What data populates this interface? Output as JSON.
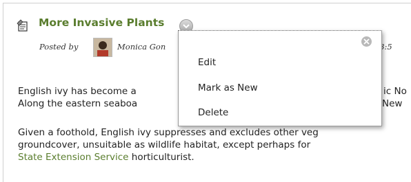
{
  "post": {
    "title": "More Invasive Plants",
    "posted_by": "Posted by",
    "author": "Monica Gon",
    "time": ":03:5"
  },
  "content": {
    "p1_line1_a": "English ivy has become a",
    "p1_line1_b": "ic No",
    "p1_line2_a": "Along the eastern seaboa",
    "p1_line2_b": "New",
    "p2_line1": "Given a foothold, English ivy suppresses and excludes other veg",
    "p2_line2": "groundcover, unsuitable as wildlife habitat, except perhaps for",
    "p2_line3_link": "State Extension Service",
    "p2_line3_rest": " horticulturist."
  },
  "menu": {
    "items": [
      "Edit",
      "Mark as New",
      "Delete"
    ]
  },
  "colors": {
    "title": "#5a7d2e",
    "link": "#5a7d2e"
  }
}
